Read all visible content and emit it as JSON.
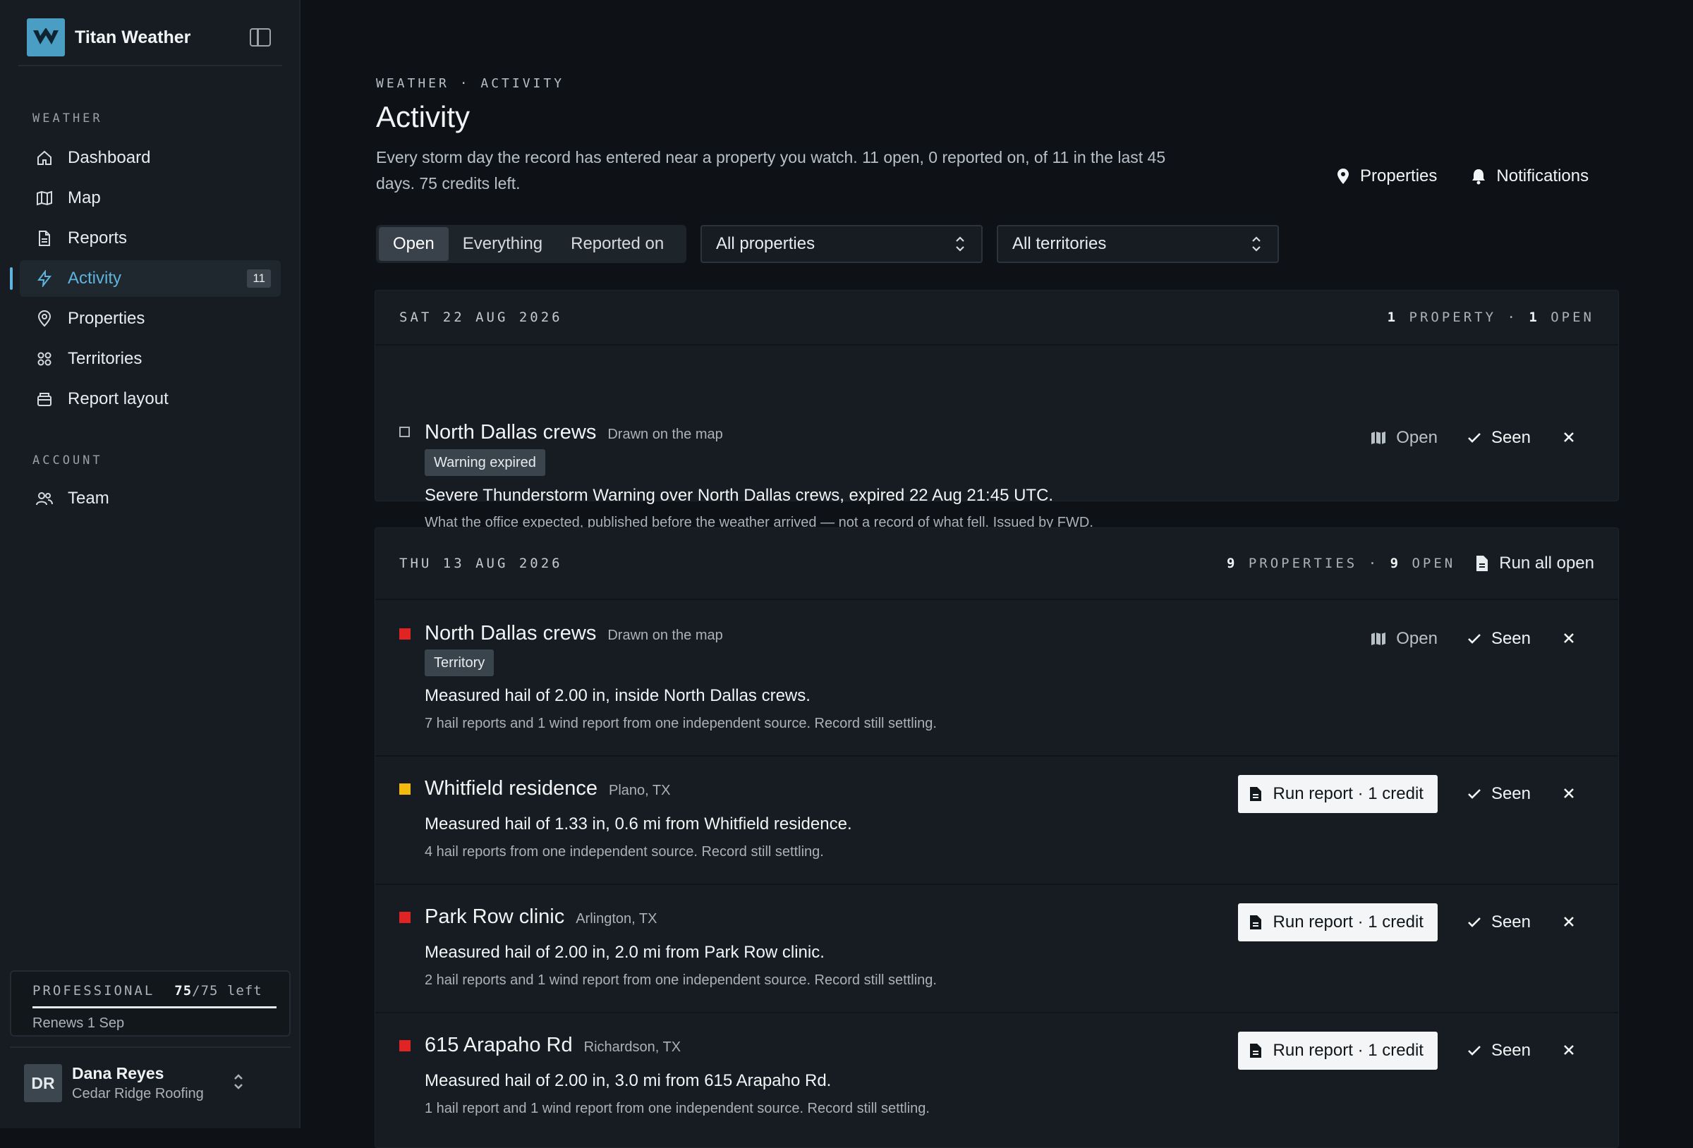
{
  "app": {
    "name": "Titan Weather"
  },
  "sidebar": {
    "section_weather": "WEATHER",
    "section_account": "ACCOUNT",
    "items": [
      {
        "label": "Dashboard",
        "icon": "home-icon"
      },
      {
        "label": "Map",
        "icon": "map-icon"
      },
      {
        "label": "Reports",
        "icon": "document-icon"
      },
      {
        "label": "Activity",
        "icon": "lightning-icon",
        "badge": "11",
        "active": true
      },
      {
        "label": "Properties",
        "icon": "pin-icon"
      },
      {
        "label": "Territories",
        "icon": "grid-icon"
      },
      {
        "label": "Report layout",
        "icon": "layout-icon"
      }
    ],
    "account_items": [
      {
        "label": "Team",
        "icon": "users-icon"
      }
    ],
    "plan": {
      "name": "PROFESSIONAL",
      "used": "75",
      "total": "/75",
      "suffix": " left",
      "renews": "Renews 1 Sep"
    },
    "user": {
      "initials": "DR",
      "name": "Dana Reyes",
      "org": "Cedar Ridge Roofing"
    }
  },
  "header": {
    "breadcrumb": "WEATHER · ACTIVITY",
    "title": "Activity",
    "description": "Every storm day the record has entered near a property you watch. 11 open, 0 reported on, of 11 in the last 45 days. 75 credits left.",
    "links": {
      "properties": "Properties",
      "notifications": "Notifications"
    }
  },
  "filters": {
    "tabs": [
      "Open",
      "Everything",
      "Reported on"
    ],
    "active_tab": "Open",
    "property_select": "All properties",
    "territory_select": "All territories"
  },
  "groups": [
    {
      "date": "SAT 22 AUG 2026",
      "count_properties": "1",
      "properties_label": " PROPERTY · ",
      "count_open": "1",
      "open_label": " OPEN",
      "rows": [
        {
          "severity": "expired",
          "title": "North Dallas crews",
          "subtitle": "Drawn on the map",
          "tag": "Warning expired",
          "main": "Severe Thunderstorm Warning over North Dallas crews, expired 22 Aug 21:45 UTC.",
          "note": "What the office expected, published before the weather arrived — not a record of what fell. Issued by FWD.",
          "action": "Open"
        }
      ]
    },
    {
      "date": "THU 13 AUG 2026",
      "count_properties": "9",
      "properties_label": " PROPERTIES · ",
      "count_open": "9",
      "open_label": " OPEN",
      "run_all": "Run all open",
      "rows": [
        {
          "severity": "red",
          "title": "North Dallas crews",
          "subtitle": "Drawn on the map",
          "tag": "Territory",
          "main": "Measured hail of 2.00 in, inside North Dallas crews.",
          "note": "7 hail reports and 1 wind report from one independent source. Record still settling.",
          "action": "Open"
        },
        {
          "severity": "amber",
          "title": "Whitfield residence",
          "subtitle": "Plano, TX",
          "main": "Measured hail of 1.33 in, 0.6 mi from Whitfield residence.",
          "note": "4 hail reports from one independent source. Record still settling.",
          "action": "Run report · 1 credit"
        },
        {
          "severity": "red",
          "title": "Park Row clinic",
          "subtitle": "Arlington, TX",
          "main": "Measured hail of 2.00 in, 2.0 mi from Park Row clinic.",
          "note": "2 hail reports and 1 wind report from one independent source. Record still settling.",
          "action": "Run report · 1 credit"
        },
        {
          "severity": "red",
          "title": "615 Arapaho Rd",
          "subtitle": "Richardson, TX",
          "main": "Measured hail of 2.00 in, 3.0 mi from 615 Arapaho Rd.",
          "note": "1 hail report and 1 wind report from one independent source. Record still settling.",
          "action": "Run report · 1 credit"
        }
      ]
    }
  ],
  "row_actions": {
    "seen": "Seen"
  },
  "colors": {
    "accent": "#5fb3dc",
    "severe": "#e02424",
    "moderate": "#f2b90f",
    "background": "#0e1216"
  }
}
